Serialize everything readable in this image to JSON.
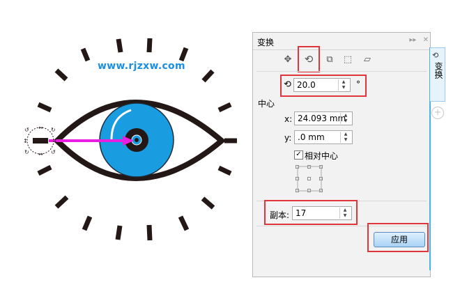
{
  "watermark": "www.rjzxw.com",
  "panel": {
    "title": "变换",
    "controls": [
      "▸▸",
      "✕"
    ],
    "tools": [
      "position-icon",
      "rotate-icon",
      "scale-icon",
      "size-icon",
      "skew-icon"
    ],
    "rotation": {
      "value": "20.0",
      "unit": "°"
    },
    "center_label": "中心",
    "x": {
      "label": "x:",
      "value": "24.093 mm"
    },
    "y": {
      "label": "y:",
      "value": ".0 mm"
    },
    "relative_center": {
      "label": "相对中心",
      "checked": true
    },
    "copies": {
      "label": "副本:",
      "value": "17"
    },
    "apply_label": "应用",
    "side_tab_label": "变换",
    "side_plus": "+"
  },
  "colors": {
    "iris": "#1a9de0",
    "outline": "#231815",
    "arrow": "#e81ee0",
    "highlight": "#e0353a"
  }
}
